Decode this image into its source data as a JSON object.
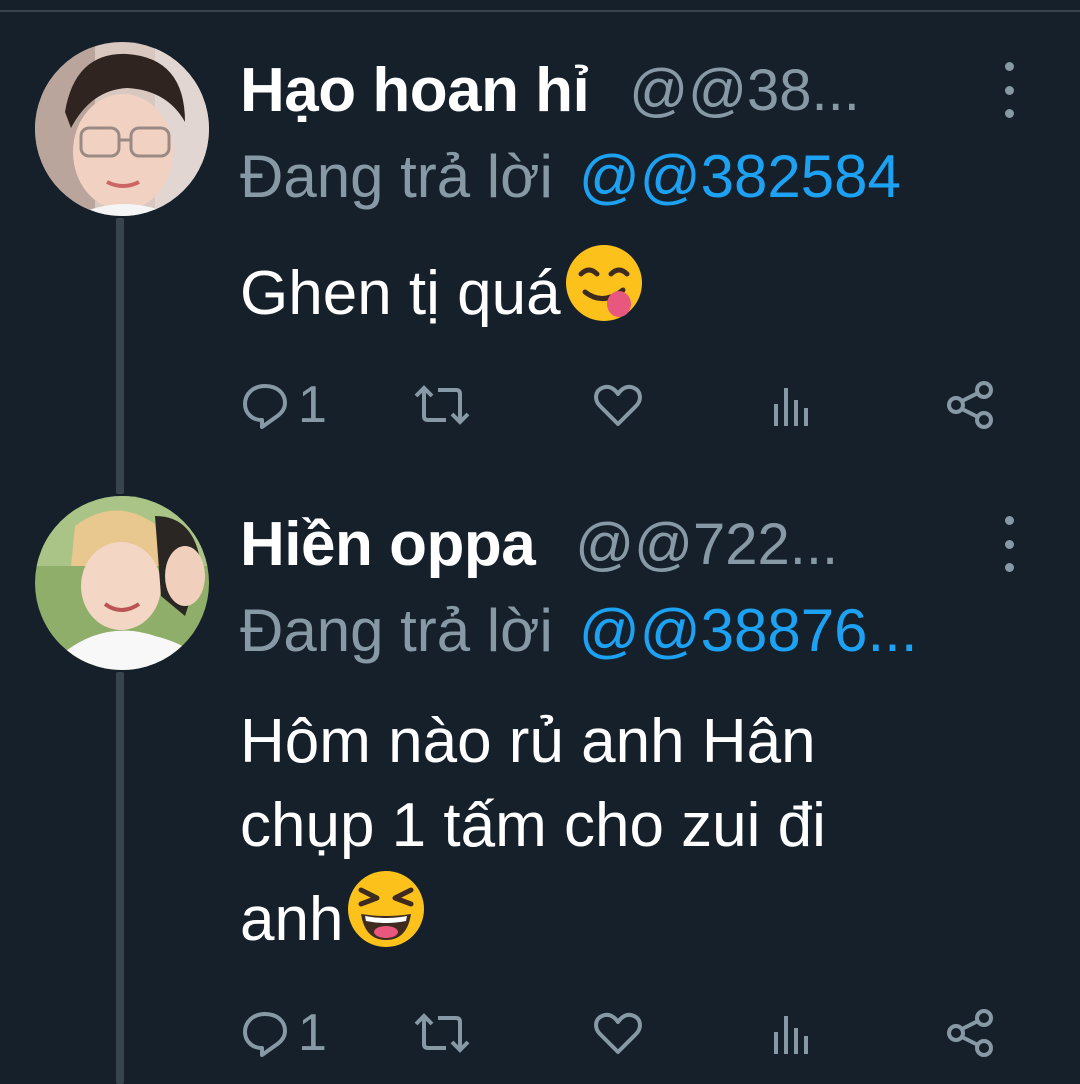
{
  "tweets": [
    {
      "display_name": "Hạo hoan hỉ",
      "handle": "@@38...",
      "reply_prefix": "Đang trả lời",
      "reply_to": "@@382584",
      "text": "Ghen tị quá",
      "emoji": "yum-face-emoji",
      "reply_count": "1",
      "avatar": "avatar-photo-boy-glasses"
    },
    {
      "display_name": "Hiền oppa",
      "handle": "@@722...",
      "reply_prefix": "Đang trả lời",
      "reply_to": "@@38876...",
      "text_lines": [
        "Hôm nào rủ anh Hân",
        "chụp 1 tấm cho zui đi",
        "anh"
      ],
      "emoji": "laughing-face-emoji",
      "reply_count": "1",
      "avatar": "avatar-photo-two-boys"
    }
  ],
  "actions": [
    "reply-icon",
    "retweet-icon",
    "like-icon",
    "analytics-icon",
    "share-icon"
  ],
  "colors": {
    "background": "#15202b",
    "divider": "#38444d",
    "secondary_text": "#8899a6",
    "link": "#1da1f2",
    "primary_text": "#ffffff"
  }
}
